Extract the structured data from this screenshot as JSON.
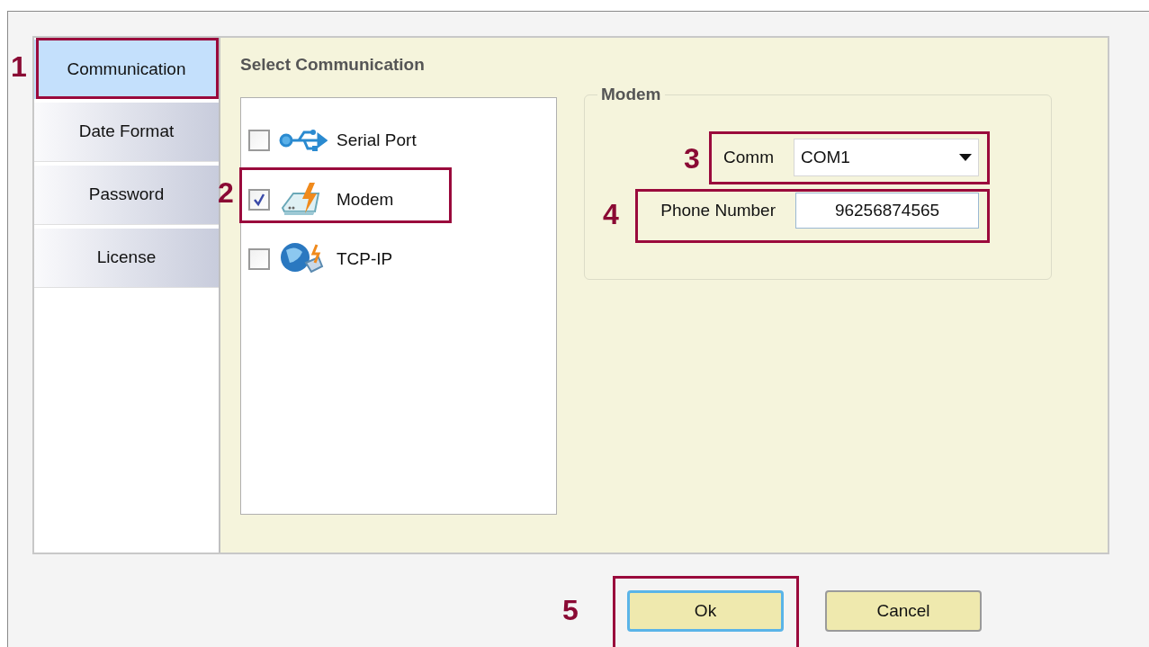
{
  "tabs": [
    {
      "label": "Communication",
      "selected": true
    },
    {
      "label": "Date Format",
      "selected": false
    },
    {
      "label": "Password",
      "selected": false
    },
    {
      "label": "License",
      "selected": false
    }
  ],
  "section_title": "Select Communication",
  "options": [
    {
      "label": "Serial Port",
      "kind": "usb",
      "checked": false
    },
    {
      "label": "Modem",
      "kind": "modem",
      "checked": true
    },
    {
      "label": "TCP-IP",
      "kind": "network",
      "checked": false
    }
  ],
  "modem_group": {
    "title": "Modem",
    "comm_label": "Comm",
    "comm_value": "COM1",
    "phone_label": "Phone Number",
    "phone_value": "96256874565"
  },
  "buttons": [
    {
      "label": "Ok",
      "focused": true
    },
    {
      "label": "Cancel",
      "focused": false
    }
  ],
  "callouts": [
    "1",
    "2",
    "3",
    "4",
    "5"
  ]
}
